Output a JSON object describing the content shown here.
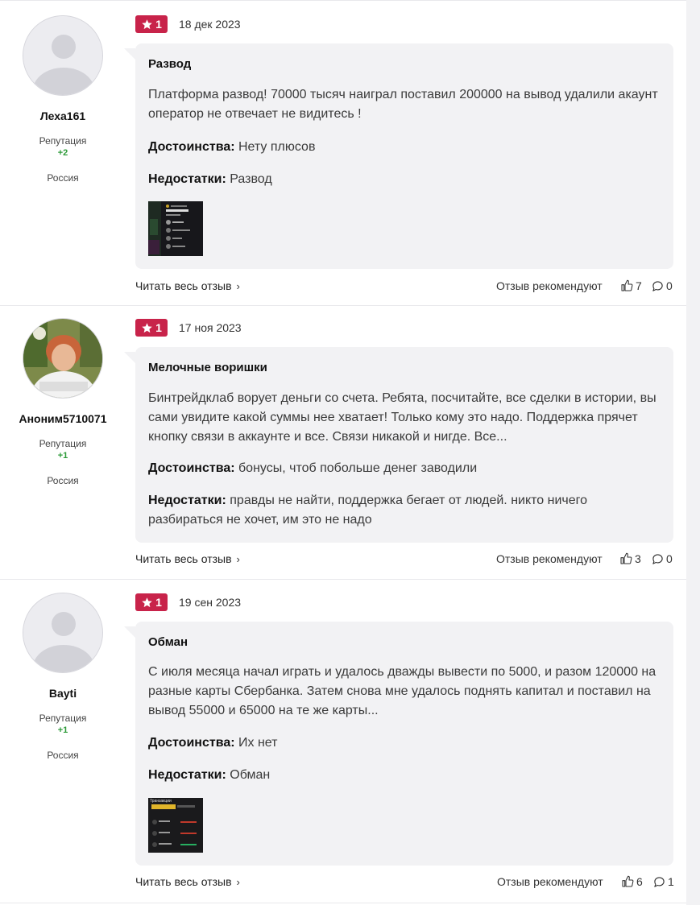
{
  "reviews": [
    {
      "rating": "1",
      "date": "18 дек 2023",
      "user": "Леха161",
      "rep_label": "Репутация",
      "rep_value": "+2",
      "country": "Россия",
      "title": "Развод",
      "text": "Платформа развод! 70000 тысяч наиграл поставил 200000 на вывод удалили акаунт оператор не отвечает не видитесь !",
      "pros_label": "Достоинства:",
      "pros": "Нету плюсов",
      "cons_label": "Недостатки:",
      "cons": "Развод",
      "read_more": "Читать весь отзыв",
      "recommend": "Отзыв рекомендуют",
      "likes": "7",
      "comments": "0"
    },
    {
      "rating": "1",
      "date": "17 ноя 2023",
      "user": "Аноним5710071",
      "rep_label": "Репутация",
      "rep_value": "+1",
      "country": "Россия",
      "title": "Мелочные воришки",
      "text": "Бинтрейдклаб ворует деньги со счета. Ребята, посчитайте, все сделки в истории, вы сами увидите какой суммы нее хватает! Только кому это надо. Поддержка прячет кнопку связи в аккаунте и все. Связи никакой и нигде. Все...",
      "pros_label": "Достоинства:",
      "pros": "бонусы, чтоб побольше денег заводили",
      "cons_label": "Недостатки:",
      "cons": "правды не найти, поддержка бегает от людей. никто ничего разбираться не хочет, им это не надо",
      "read_more": "Читать весь отзыв",
      "recommend": "Отзыв рекомендуют",
      "likes": "3",
      "comments": "0"
    },
    {
      "rating": "1",
      "date": "19 сен 2023",
      "user": "Bayti",
      "rep_label": "Репутация",
      "rep_value": "+1",
      "country": "Россия",
      "title": "Обман",
      "text": "С июля месяца начал играть и удалось дважды вывести по 5000, и разом 120000 на разные карты Сбербанка. Затем снова мне удалось поднять капитал и поставил на вывод 55000 и 65000 на те же карты...",
      "pros_label": "Достоинства:",
      "pros": "Их нет",
      "cons_label": "Недостатки:",
      "cons": "Обман",
      "read_more": "Читать весь отзыв",
      "recommend": "Отзыв рекомендуют",
      "likes": "6",
      "comments": "1"
    }
  ],
  "thumb3_label": "Транзакции",
  "colors": {
    "rating_bg": "#c8234a",
    "rep_positive": "#2e9b3a",
    "bubble_bg": "#f2f2f4"
  }
}
